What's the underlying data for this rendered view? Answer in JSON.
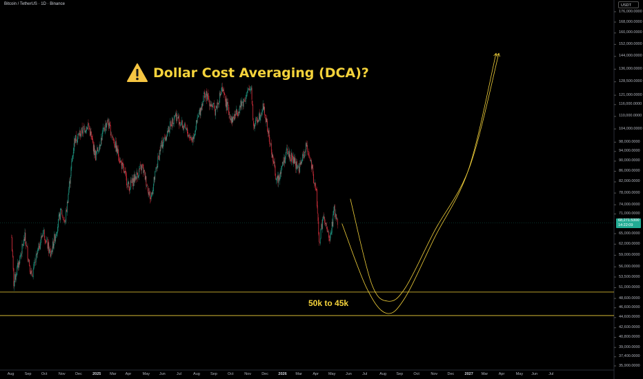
{
  "header": {
    "symbol_text": "Bitcoin / TetherUS · 1D · Binance"
  },
  "title": {
    "icon": "warning-icon",
    "text": "Dollar Cost Averaging (DCA)?"
  },
  "zone_label": "50k to 45k",
  "colors": {
    "accent": "#f5d33b",
    "up": "#22ab94",
    "down": "#f23645",
    "background": "#000000"
  },
  "chart_data": {
    "type": "candlestick",
    "y_axis": {
      "unit": "USDT",
      "ticks": [
        "176,000.0000",
        "168,000.0000",
        "160,000.0000",
        "152,000.0000",
        "144,000.0000",
        "136,000.0000",
        "128,500.0000",
        "121,000.0000",
        "116,000.0000",
        "110,000.0000",
        "104,000.0000",
        "98,000.0000",
        "94,000.0000",
        "90,000.0000",
        "86,000.0000",
        "82,000.0000",
        "78,000.0000",
        "74,000.0000",
        "71,000.0000",
        "65,000.0000",
        "62,000.0000",
        "59,000.0000",
        "56,000.0000",
        "53,500.0000",
        "51,000.0000",
        "48,600.0000",
        "46,600.0000",
        "44,600.0000",
        "42,600.0000",
        "40,800.0000",
        "39,000.0000",
        "37,400.0000",
        "35,900.0000"
      ],
      "scale": "log"
    },
    "x_axis": {
      "ticks": [
        "Aug",
        "Sep",
        "Oct",
        "Nov",
        "Dec",
        "2025",
        "Mar",
        "Apr",
        "May",
        "Jun",
        "Jul",
        "Aug",
        "Sep",
        "Oct",
        "Nov",
        "Dec",
        "2026",
        "Mar",
        "Apr",
        "May",
        "Jun",
        "Jul",
        "Aug",
        "Sep",
        "Oct",
        "Nov",
        "Dec",
        "2027",
        "Mar",
        "Apr",
        "May",
        "Jun",
        "Jul"
      ]
    },
    "last_price": {
      "value": "68,271.5300",
      "countdown": "14:22:09"
    },
    "horizontal_levels": [
      50000,
      45000
    ],
    "price_path": [
      [
        "2024-08-01",
        64000
      ],
      [
        "2024-08-05",
        52000
      ],
      [
        "2024-08-25",
        64000
      ],
      [
        "2024-09-06",
        53500
      ],
      [
        "2024-09-27",
        66000
      ],
      [
        "2024-10-10",
        59000
      ],
      [
        "2024-10-29",
        72000
      ],
      [
        "2024-11-05",
        68000
      ],
      [
        "2024-11-22",
        99000
      ],
      [
        "2024-12-17",
        106000
      ],
      [
        "2024-12-30",
        92000
      ],
      [
        "2025-01-20",
        108000
      ],
      [
        "2025-02-03",
        97000
      ],
      [
        "2025-02-28",
        80000
      ],
      [
        "2025-03-24",
        88000
      ],
      [
        "2025-04-08",
        76000
      ],
      [
        "2025-04-25",
        95000
      ],
      [
        "2025-05-22",
        111000
      ],
      [
        "2025-06-22",
        99000
      ],
      [
        "2025-07-14",
        122000
      ],
      [
        "2025-08-02",
        113000
      ],
      [
        "2025-08-14",
        124000
      ],
      [
        "2025-09-01",
        108000
      ],
      [
        "2025-09-20",
        117000
      ],
      [
        "2025-10-06",
        126000
      ],
      [
        "2025-10-10",
        105000
      ],
      [
        "2025-10-28",
        115000
      ],
      [
        "2025-11-21",
        82000
      ],
      [
        "2025-12-09",
        94000
      ],
      [
        "2025-12-31",
        87000
      ],
      [
        "2026-01-14",
        97000
      ],
      [
        "2026-01-31",
        78000
      ],
      [
        "2026-02-05",
        62000
      ],
      [
        "2026-02-12",
        70000
      ],
      [
        "2026-02-24",
        63000
      ],
      [
        "2026-03-04",
        72000
      ],
      [
        "2026-03-10",
        68271
      ]
    ],
    "projection_curves": [
      {
        "points": [
          [
            "2026-04-02",
            76000
          ],
          [
            "2026-05-10",
            52000
          ],
          [
            "2026-06-09",
            48000
          ],
          [
            "2026-07-10",
            51000
          ],
          [
            "2026-09-01",
            66000
          ],
          [
            "2026-11-03",
            88000
          ],
          [
            "2026-12-25",
            146000
          ]
        ]
      },
      {
        "points": [
          [
            "2026-03-18",
            68000
          ],
          [
            "2026-05-01",
            51000
          ],
          [
            "2026-06-05",
            45500
          ],
          [
            "2026-07-08",
            48500
          ],
          [
            "2026-09-01",
            64000
          ],
          [
            "2026-11-01",
            87000
          ],
          [
            "2026-12-20",
            146000
          ]
        ]
      }
    ]
  }
}
